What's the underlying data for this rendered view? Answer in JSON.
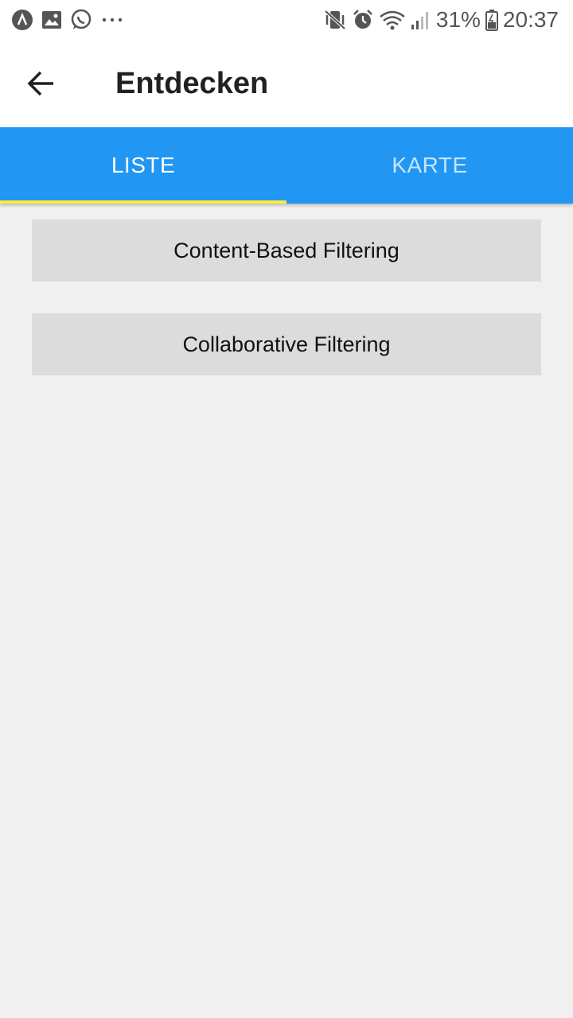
{
  "status_bar": {
    "left_icons": [
      "app-a-icon",
      "gallery-icon",
      "whatsapp-icon",
      "more-dots-icon"
    ],
    "right_icons": [
      "vibrate-mute-icon",
      "alarm-icon",
      "wifi-icon",
      "signal-icon",
      "battery-icon"
    ],
    "battery_percent": "31%",
    "time": "20:37"
  },
  "app_bar": {
    "title": "Entdecken"
  },
  "tabs": [
    {
      "label": "LISTE",
      "active": true
    },
    {
      "label": "KARTE",
      "active": false
    }
  ],
  "list": {
    "items": [
      {
        "label": "Content-Based Filtering"
      },
      {
        "label": "Collaborative Filtering"
      }
    ]
  },
  "colors": {
    "tab_bar": "#2196f3",
    "tab_indicator": "#ffeb3b",
    "background": "#f0f0f0",
    "button": "#dcdcdc"
  }
}
